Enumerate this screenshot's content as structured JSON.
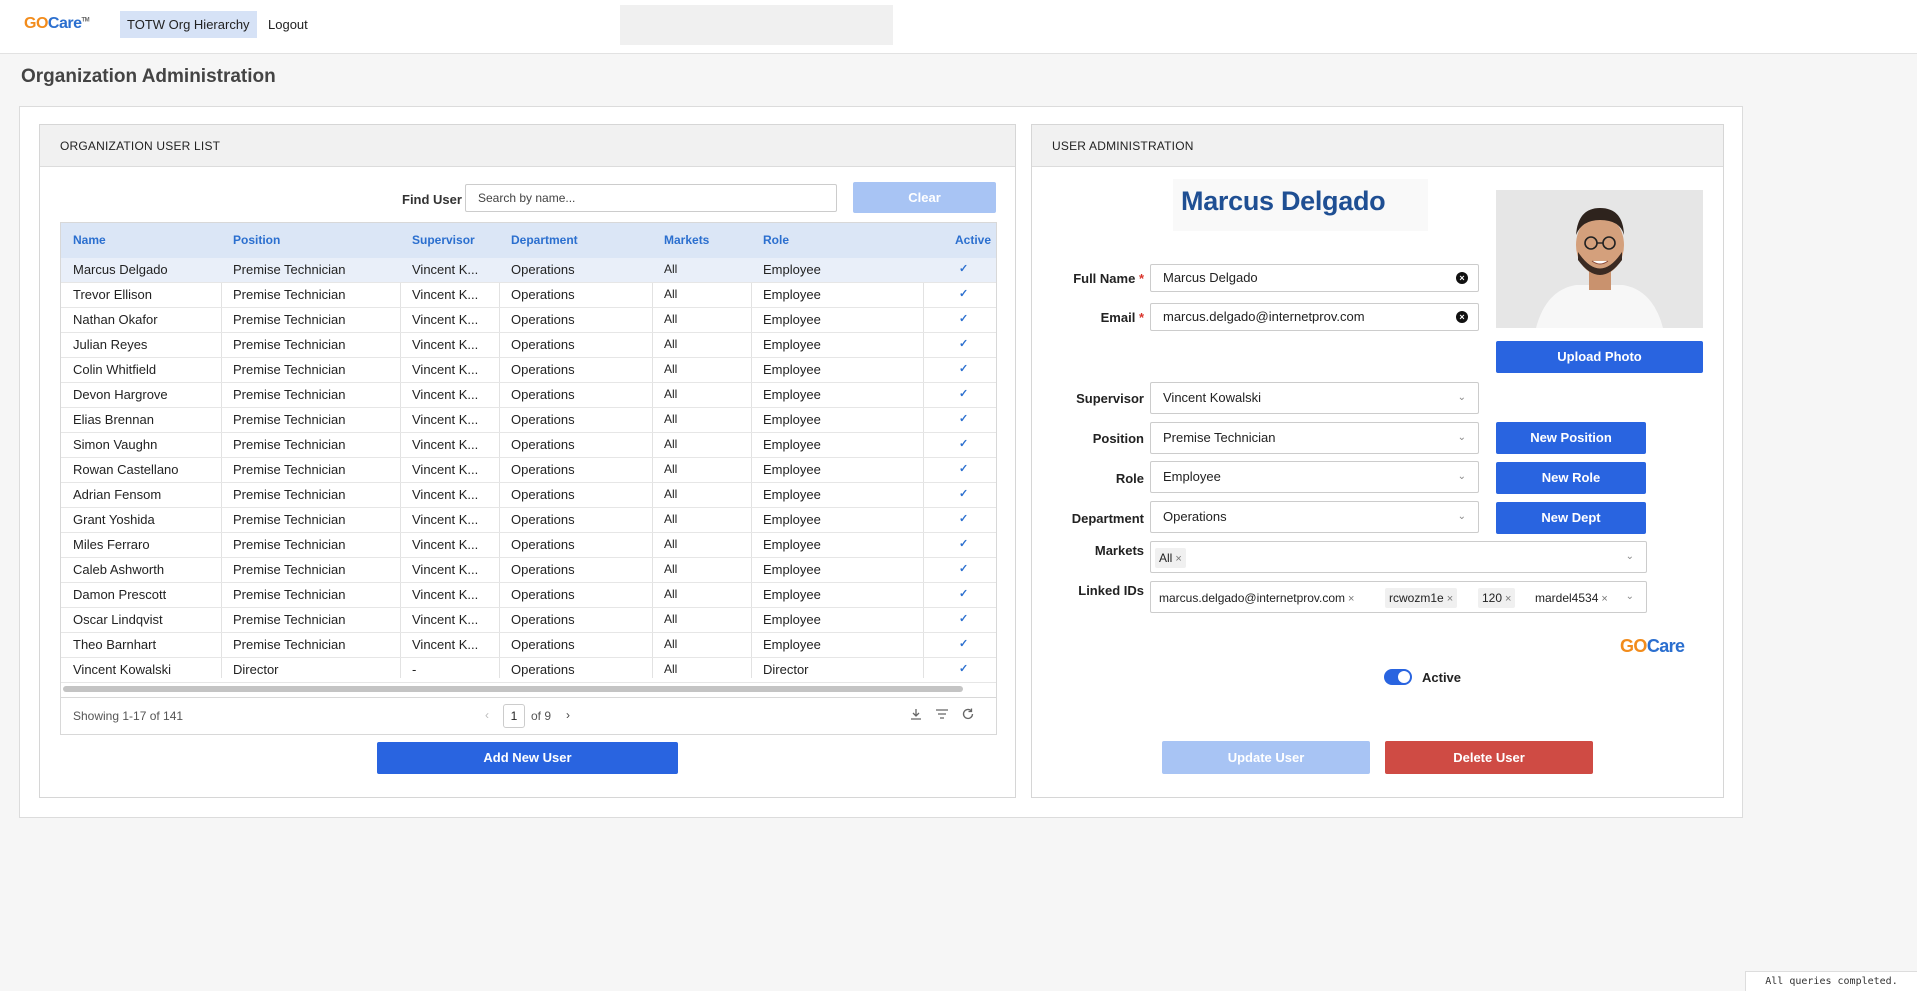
{
  "brand": {
    "go": "GO",
    "care": "Care",
    "tm": "TM"
  },
  "nav": {
    "hierarchy_label": "TOTW Org Hierarchy",
    "logout_label": "Logout"
  },
  "page_title": "Organization Administration",
  "user_list": {
    "header": "ORGANIZATION USER LIST",
    "find_label": "Find User",
    "search_placeholder": "Search by name...",
    "clear_label": "Clear",
    "columns": [
      "Name",
      "Position",
      "Supervisor",
      "Department",
      "Markets",
      "Role",
      "Active"
    ],
    "rows": [
      [
        "Marcus Delgado",
        "Premise Technician",
        "Vincent K...",
        "Operations",
        "All",
        "Employee"
      ],
      [
        "Trevor Ellison",
        "Premise Technician",
        "Vincent K...",
        "Operations",
        "All",
        "Employee"
      ],
      [
        "Nathan Okafor",
        "Premise Technician",
        "Vincent K...",
        "Operations",
        "All",
        "Employee"
      ],
      [
        "Julian Reyes",
        "Premise Technician",
        "Vincent K...",
        "Operations",
        "All",
        "Employee"
      ],
      [
        "Colin Whitfield",
        "Premise Technician",
        "Vincent K...",
        "Operations",
        "All",
        "Employee"
      ],
      [
        "Devon Hargrove",
        "Premise Technician",
        "Vincent K...",
        "Operations",
        "All",
        "Employee"
      ],
      [
        "Elias Brennan",
        "Premise Technician",
        "Vincent K...",
        "Operations",
        "All",
        "Employee"
      ],
      [
        "Simon Vaughn",
        "Premise Technician",
        "Vincent K...",
        "Operations",
        "All",
        "Employee"
      ],
      [
        "Rowan Castellano",
        "Premise Technician",
        "Vincent K...",
        "Operations",
        "All",
        "Employee"
      ],
      [
        "Adrian Fensom",
        "Premise Technician",
        "Vincent K...",
        "Operations",
        "All",
        "Employee"
      ],
      [
        "Grant Yoshida",
        "Premise Technician",
        "Vincent K...",
        "Operations",
        "All",
        "Employee"
      ],
      [
        "Miles Ferraro",
        "Premise Technician",
        "Vincent K...",
        "Operations",
        "All",
        "Employee"
      ],
      [
        "Caleb Ashworth",
        "Premise Technician",
        "Vincent K...",
        "Operations",
        "All",
        "Employee"
      ],
      [
        "Damon Prescott",
        "Premise Technician",
        "Vincent K...",
        "Operations",
        "All",
        "Employee"
      ],
      [
        "Oscar Lindqvist",
        "Premise Technician",
        "Vincent K...",
        "Operations",
        "All",
        "Employee"
      ],
      [
        "Theo Barnhart",
        "Premise Technician",
        "Vincent K...",
        "Operations",
        "All",
        "Employee"
      ],
      [
        "Vincent Kowalski",
        "Director",
        "-",
        "Operations",
        "All",
        "Director"
      ]
    ],
    "active_glyph": "✓",
    "pager": {
      "showing": "Showing 1-17 of 141",
      "page": "1",
      "of": "of 9"
    },
    "add_label": "Add New User"
  },
  "admin": {
    "header": "USER ADMINISTRATION",
    "display_name": "Marcus Delgado",
    "upload_label": "Upload Photo",
    "full_name_label": "Full Name",
    "full_name_value": "Marcus Delgado",
    "email_label": "Email",
    "email_value": "marcus.delgado@internetprov.com",
    "required_mark": "*",
    "supervisor_label": "Supervisor",
    "supervisor_value": "Vincent Kowalski",
    "position_label": "Position",
    "position_value": "Premise Technician",
    "role_label": "Role",
    "role_value": "Employee",
    "department_label": "Department",
    "department_value": "Operations",
    "markets_label": "Markets",
    "markets_chip": "All",
    "linked_label": "Linked IDs",
    "linked_ids": [
      "marcus.delgado@internetprov.com",
      "rcwozm1e",
      "120",
      "mardel4534"
    ],
    "new_position_label": "New Position",
    "new_role_label": "New Role",
    "new_dept_label": "New Dept",
    "active_label": "Active",
    "active": true,
    "update_label": "Update User",
    "delete_label": "Delete User"
  },
  "colors": {
    "primary": "#2964e0",
    "primary_disabled": "#a8c4f4",
    "danger": "#cf4b44",
    "brand_orange": "#f28c1c",
    "brand_blue": "#2b6fcf"
  },
  "status_text": "All queries completed."
}
